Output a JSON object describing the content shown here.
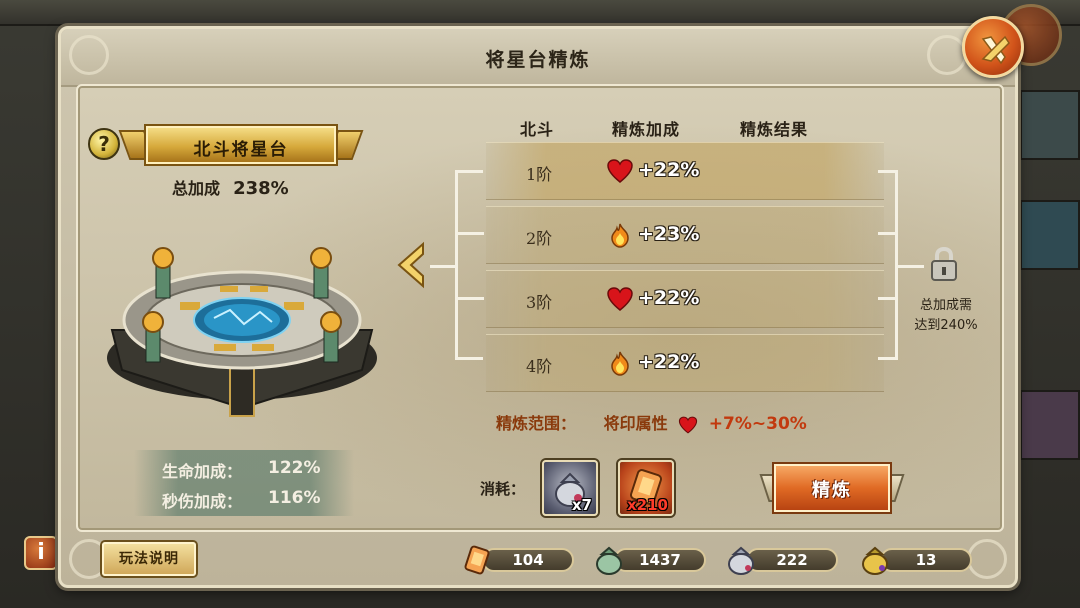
{
  "window": {
    "title": "将星台精炼"
  },
  "header": {
    "help_icon": "?",
    "banner_title": "北斗将星台"
  },
  "summary": {
    "total_label": "总加成",
    "total_value": "238%"
  },
  "stats": {
    "hp_label": "生命加成：",
    "hp_value": "122%",
    "dps_label": "秒伤加成：",
    "dps_value": "116%"
  },
  "table": {
    "headers": [
      "北斗",
      "精炼加成",
      "精炼结果"
    ],
    "rows": [
      {
        "tier": "1阶",
        "icon": "heart-icon",
        "bonus": "+22%"
      },
      {
        "tier": "2阶",
        "icon": "flame-icon",
        "bonus": "+23%"
      },
      {
        "tier": "3阶",
        "icon": "heart-icon",
        "bonus": "+22%"
      },
      {
        "tier": "4阶",
        "icon": "flame-icon",
        "bonus": "+22%"
      }
    ]
  },
  "lock": {
    "line1": "总加成需",
    "line2": "达到240%"
  },
  "range": {
    "label": "精炼范围：",
    "attr": "将印属性",
    "value": "+7%~30%"
  },
  "cost": {
    "label": "消耗：",
    "items": [
      {
        "icon": "silver-bag-icon",
        "qty": "x7"
      },
      {
        "icon": "bronze-token-icon",
        "qty": "x210"
      }
    ]
  },
  "refine_button": "精炼",
  "footer": {
    "rules_button": "玩法说明",
    "resources": [
      {
        "icon": "bronze-token-icon",
        "value": "104"
      },
      {
        "icon": "green-bag-icon",
        "value": "1437"
      },
      {
        "icon": "silver-bag-icon",
        "value": "222"
      },
      {
        "icon": "gold-bag-icon",
        "value": "13"
      }
    ]
  },
  "colors": {
    "panel": "#c9c0a8",
    "accent_orange": "#e06a24",
    "gold": "#d6a93b",
    "stat_green": "#466e60",
    "range_red": "#c2390e"
  },
  "background": {
    "info_button": "i"
  }
}
